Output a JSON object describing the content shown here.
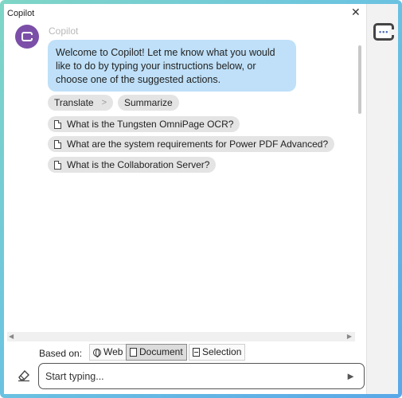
{
  "window": {
    "title": "Copilot",
    "close_glyph": "✕"
  },
  "bot": {
    "name": "Copilot",
    "avatar_icon": "copilot-icon",
    "avatar_color": "#7b4fa8"
  },
  "welcome_message": "Welcome to Copilot! Let me know what you would like to do by typing your instructions below, or choose one of the suggested actions.",
  "actions": {
    "translate": "Translate",
    "summarize": "Summarize"
  },
  "suggestions": [
    "What is the Tungsten OmniPage OCR?",
    "What are the system requirements for Power PDF Advanced?",
    "What is the Collaboration Server?"
  ],
  "based_on": {
    "label": "Based on:",
    "options": [
      {
        "label": "Web",
        "icon": "globe-icon",
        "selected": false
      },
      {
        "label": "Document",
        "icon": "document-icon",
        "selected": true
      },
      {
        "label": "Selection",
        "icon": "selection-icon",
        "selected": false
      }
    ]
  },
  "input": {
    "placeholder": "Start typing...",
    "value": ""
  },
  "colors": {
    "bubble": "#bfe0f8",
    "chip": "#e4e4e4",
    "accent": "#7b4fa8"
  }
}
